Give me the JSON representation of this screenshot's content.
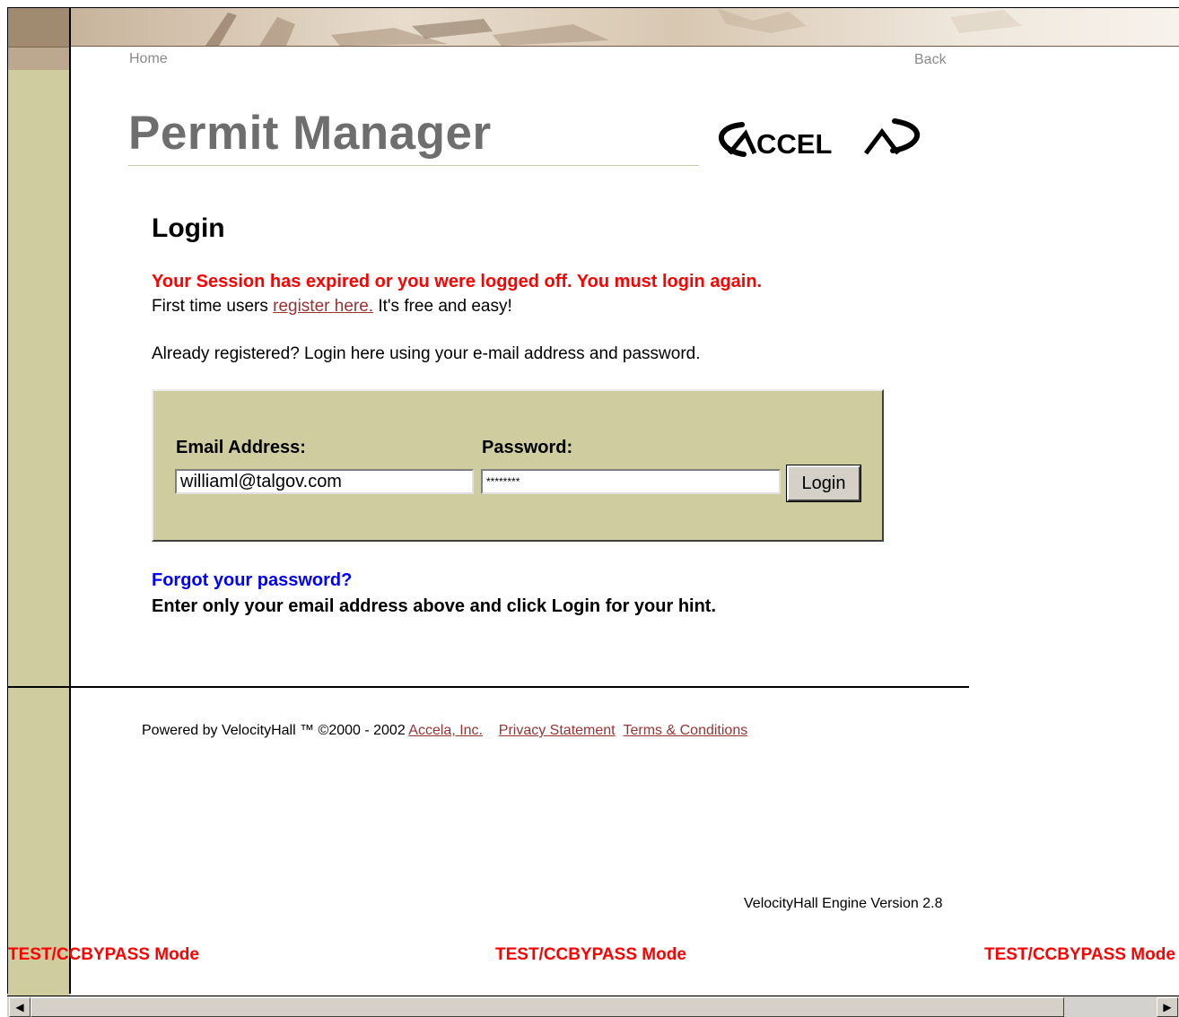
{
  "header": {
    "home_label": "Home",
    "back_label": "Back",
    "app_title": "Permit Manager",
    "logo_text": "ACCELA"
  },
  "login": {
    "heading": "Login",
    "session_message": "Your Session has expired or you were logged off. You must login again.",
    "first_time_prefix": "First time users ",
    "register_link": "register here.",
    "first_time_suffix": " It's free and easy!",
    "already_registered": "Already registered? Login here using your e-mail address and password.",
    "email_label": "Email Address:",
    "email_value": "williaml@talgov.com",
    "password_label": "Password:",
    "password_value": "********",
    "login_button": "Login",
    "forgot_link": "Forgot your password?",
    "forgot_hint": "Enter only your email address above and click Login for your hint."
  },
  "footer": {
    "powered_by": "Powered by VelocityHall ™ ©2000 - 2002 ",
    "accela_link": "Accela, Inc.",
    "privacy_link": "Privacy Statement",
    "terms_link": "Terms & Conditions",
    "engine_version": "VelocityHall Engine Version 2.8",
    "mode_label": "TEST/CCBYPASS Mode"
  },
  "colors": {
    "rail": "#cfcd9f",
    "error_text": "#ff0000",
    "link_blue": "#0000ff",
    "link_maroon": "#993333"
  }
}
